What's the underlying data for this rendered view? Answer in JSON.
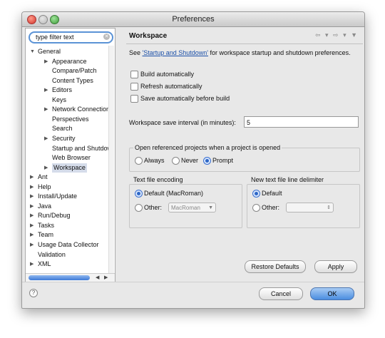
{
  "window": {
    "title": "Preferences"
  },
  "filter": {
    "value": "type filter text"
  },
  "tree": {
    "items": [
      {
        "label": "General",
        "twisty": "▼",
        "level": 0
      },
      {
        "label": "Appearance",
        "twisty": "▶",
        "level": 1
      },
      {
        "label": "Compare/Patch",
        "twisty": "",
        "level": 1
      },
      {
        "label": "Content Types",
        "twisty": "",
        "level": 1
      },
      {
        "label": "Editors",
        "twisty": "▶",
        "level": 1
      },
      {
        "label": "Keys",
        "twisty": "",
        "level": 1
      },
      {
        "label": "Network Connections",
        "twisty": "▶",
        "level": 1
      },
      {
        "label": "Perspectives",
        "twisty": "",
        "level": 1
      },
      {
        "label": "Search",
        "twisty": "",
        "level": 1
      },
      {
        "label": "Security",
        "twisty": "▶",
        "level": 1
      },
      {
        "label": "Startup and Shutdown",
        "twisty": "",
        "level": 1
      },
      {
        "label": "Web Browser",
        "twisty": "",
        "level": 1
      },
      {
        "label": "Workspace",
        "twisty": "▶",
        "level": 1,
        "selected": true
      },
      {
        "label": "Ant",
        "twisty": "▶",
        "level": 0
      },
      {
        "label": "Help",
        "twisty": "▶",
        "level": 0
      },
      {
        "label": "Install/Update",
        "twisty": "▶",
        "level": 0
      },
      {
        "label": "Java",
        "twisty": "▶",
        "level": 0
      },
      {
        "label": "Run/Debug",
        "twisty": "▶",
        "level": 0
      },
      {
        "label": "Tasks",
        "twisty": "▶",
        "level": 0
      },
      {
        "label": "Team",
        "twisty": "▶",
        "level": 0
      },
      {
        "label": "Usage Data Collector",
        "twisty": "▶",
        "level": 0
      },
      {
        "label": "Validation",
        "twisty": "",
        "level": 0
      },
      {
        "label": "XML",
        "twisty": "▶",
        "level": 0
      }
    ]
  },
  "page": {
    "title": "Workspace",
    "nav_arrows": "⇦ ▾ ⇨ ▾ ▼",
    "desc_prefix": "See ",
    "desc_link": "'Startup and Shutdown'",
    "desc_suffix": " for workspace startup and shutdown preferences.",
    "checkboxes": [
      {
        "label": "Build automatically",
        "checked": false
      },
      {
        "label": "Refresh automatically",
        "checked": false
      },
      {
        "label": "Save automatically before build",
        "checked": false
      }
    ],
    "save_interval_label": "Workspace save interval (in minutes):",
    "save_interval_value": "5",
    "open_ref": {
      "title": "Open referenced projects when a project is opened",
      "options": [
        "Always",
        "Never",
        "Prompt"
      ],
      "selected": "Prompt"
    },
    "encoding": {
      "title": "Text file encoding",
      "default_label": "Default (MacRoman)",
      "other_label": "Other:",
      "other_value": "MacRoman",
      "selected": "default"
    },
    "delimiter": {
      "title": "New text file line delimiter",
      "default_label": "Default",
      "other_label": "Other:",
      "other_value": "",
      "selected": "default"
    },
    "restore_defaults": "Restore Defaults",
    "apply": "Apply"
  },
  "footer": {
    "help": "?",
    "cancel": "Cancel",
    "ok": "OK"
  },
  "colors": {
    "accent": "#4a8de0",
    "link": "#1b4fa8",
    "selection": "#d5dcea"
  }
}
